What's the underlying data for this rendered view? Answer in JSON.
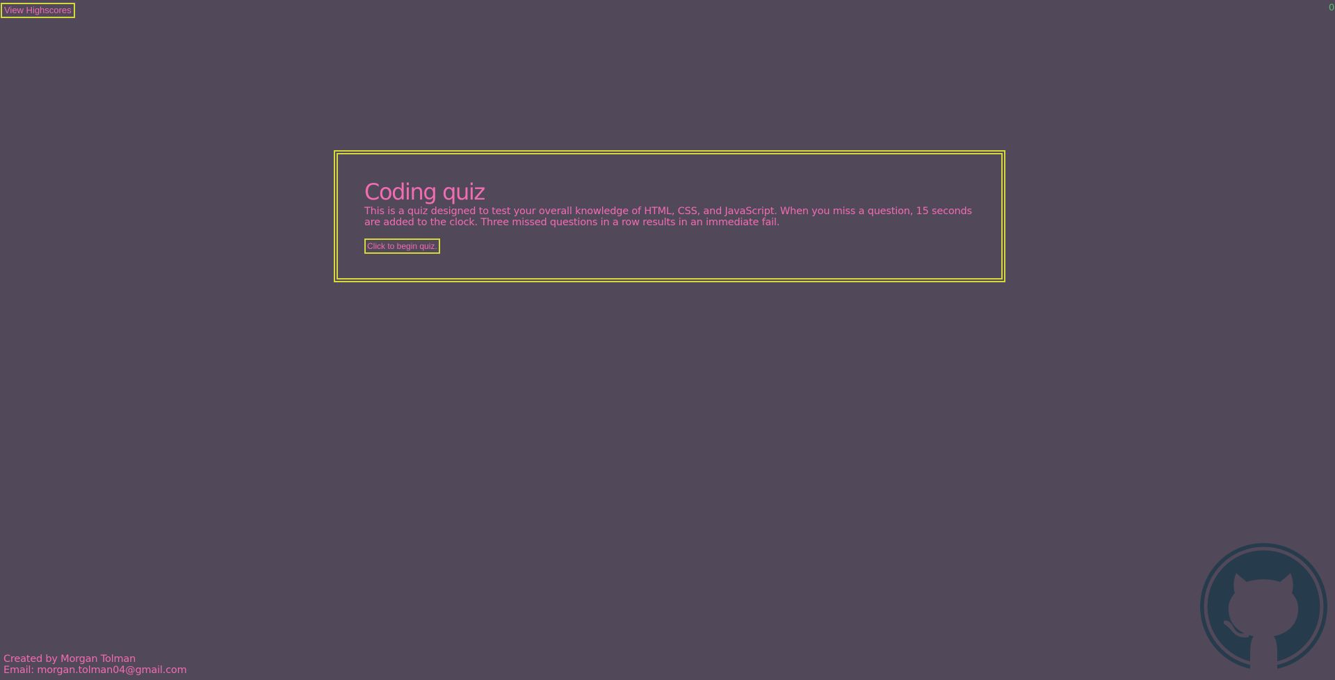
{
  "header": {
    "highscores_label": "View Highscores",
    "timer_value": "0"
  },
  "quiz": {
    "title": "Coding quiz",
    "description": "This is a quiz designed to test your overall knowledge of HTML, CSS, and JavaScript. When you miss a question, 15 seconds are added to the clock. Three missed questions in a row results in an immediate fail.",
    "begin_label": "Click to begin quiz."
  },
  "footer": {
    "created_by": "Created by Morgan Tolman",
    "email": "Email: morgan.tolman04@gmail.com"
  },
  "icons": {
    "github": "github-icon"
  },
  "colors": {
    "background": "#514959",
    "text": "#f26cb2",
    "border": "#d7d83a",
    "timer": "#59c96b",
    "github_icon": "#263c4c"
  }
}
